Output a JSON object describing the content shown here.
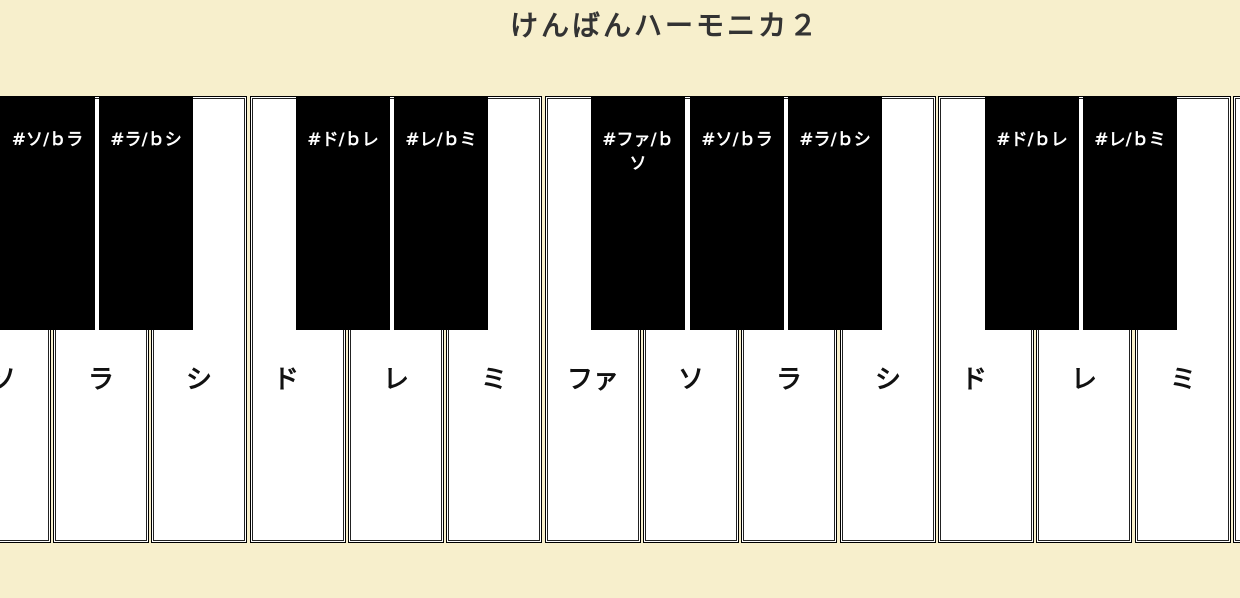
{
  "title": "けんばんハーモニカ２",
  "white_keys": [
    {
      "label": "ソ"
    },
    {
      "label": "ラ"
    },
    {
      "label": "シ"
    },
    {
      "label": "ド"
    },
    {
      "label": "レ"
    },
    {
      "label": "ミ"
    },
    {
      "label": "ファ"
    },
    {
      "label": "ソ"
    },
    {
      "label": "ラ"
    },
    {
      "label": "シ"
    },
    {
      "label": "ド"
    },
    {
      "label": "レ"
    },
    {
      "label": "ミ"
    },
    {
      "label": ""
    }
  ],
  "black_keys": [
    {
      "label": "#ソ/ｂラ"
    },
    {
      "label": "#ラ/ｂシ"
    },
    {
      "label": "#ド/ｂレ"
    },
    {
      "label": "#レ/ｂミ"
    },
    {
      "label": "#ファ/ｂソ"
    },
    {
      "label": "#ソ/ｂラ"
    },
    {
      "label": "#ラ/ｂシ"
    },
    {
      "label": "#ド/ｂレ"
    },
    {
      "label": "#レ/ｂミ"
    }
  ]
}
